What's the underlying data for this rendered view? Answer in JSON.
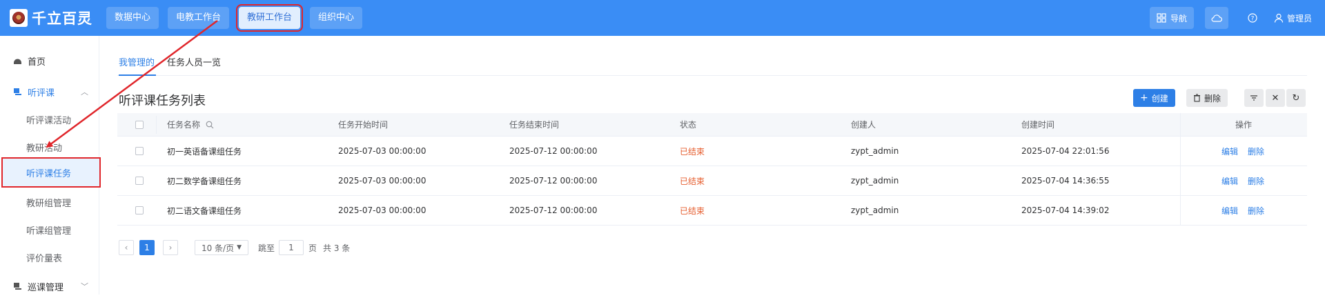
{
  "brand": {
    "name": "千立百灵"
  },
  "top_nav": [
    {
      "label": "数据中心"
    },
    {
      "label": "电教工作台"
    },
    {
      "label": "教研工作台"
    },
    {
      "label": "组织中心"
    }
  ],
  "top_right": {
    "nav_label": "导航",
    "user_label": "管理员"
  },
  "sidebar": {
    "home": "首页",
    "group_listen": "听评课",
    "sub_items": [
      "听评课活动",
      "教研活动",
      "听评课任务",
      "教研组管理",
      "听课组管理",
      "评价量表"
    ],
    "group_patrol": "巡课管理"
  },
  "tabs": [
    "我管理的",
    "任务人员一览"
  ],
  "list": {
    "title": "听评课任务列表",
    "create_label": "创建",
    "delete_label": "删除"
  },
  "table": {
    "headers": [
      "任务名称",
      "任务开始时间",
      "任务结束时间",
      "状态",
      "创建人",
      "创建时间",
      "操作"
    ],
    "rows": [
      {
        "name": "初一英语备课组任务",
        "start": "2025-07-03 00:00:00",
        "end": "2025-07-12 00:00:00",
        "status": "已结束",
        "creator": "zypt_admin",
        "created": "2025-07-04 22:01:56"
      },
      {
        "name": "初二数学备课组任务",
        "start": "2025-07-03 00:00:00",
        "end": "2025-07-12 00:00:00",
        "status": "已结束",
        "creator": "zypt_admin",
        "created": "2025-07-04 14:36:55"
      },
      {
        "name": "初二语文备课组任务",
        "start": "2025-07-03 00:00:00",
        "end": "2025-07-12 00:00:00",
        "status": "已结束",
        "creator": "zypt_admin",
        "created": "2025-07-04 14:39:02"
      }
    ],
    "edit_label": "编辑",
    "delete_label": "删除"
  },
  "pagination": {
    "current_page": "1",
    "page_size": "10 条/页",
    "jump_prefix": "跳至",
    "jump_value": "1",
    "jump_suffix": "页",
    "total": "共 3 条"
  },
  "colors": {
    "primary": "#2d7fe6",
    "topbar": "#3a8df5",
    "status_ended": "#e65d2e",
    "highlight": "#e0262b"
  }
}
